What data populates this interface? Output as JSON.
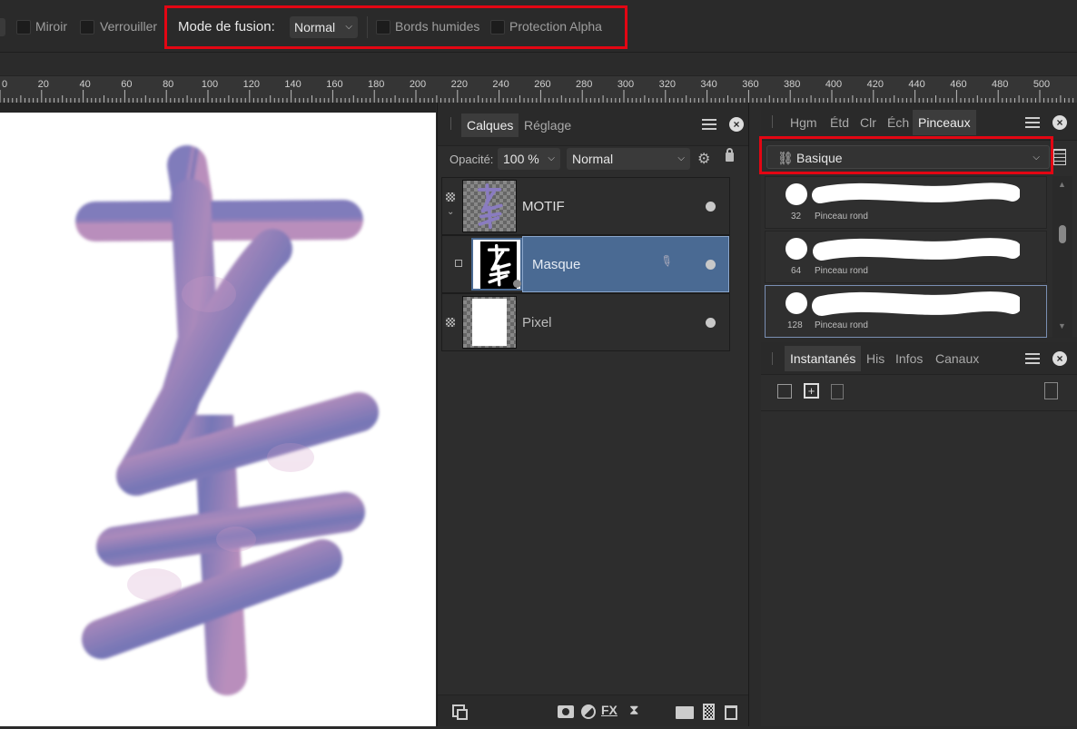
{
  "toolbar": {
    "mirror_label": "Miroir",
    "lock_label": "Verrouiller",
    "blend_mode_label": "Mode de fusion:",
    "blend_mode_value": "Normal",
    "wet_edges_label": "Bords humides",
    "protect_alpha_label": "Protection Alpha"
  },
  "ruler": {
    "ticks": [
      "0",
      "20",
      "40",
      "60",
      "80",
      "100",
      "120",
      "140",
      "160",
      "180",
      "200",
      "220",
      "240",
      "260",
      "280",
      "300",
      "320",
      "340",
      "360",
      "380",
      "400",
      "420",
      "440",
      "460",
      "480",
      "500"
    ]
  },
  "layers_panel": {
    "tabs": [
      "Calques",
      "Réglage"
    ],
    "opacity_label": "Opacité:",
    "opacity_value": "100 %",
    "blend_value": "Normal",
    "layers": [
      {
        "name": "MOTIF"
      },
      {
        "name": "Masque"
      },
      {
        "name": "Pixel"
      }
    ],
    "bottom_icons": [
      "layers-stack-icon",
      "mask-icon",
      "adjustment-icon",
      "fx-icon",
      "hourglass-icon",
      "folder-icon",
      "group-icon",
      "trash-icon"
    ]
  },
  "brushes_panel": {
    "tabs": [
      "Hgm",
      "Étd",
      "Clr",
      "Éch",
      "Pinceaux"
    ],
    "category_value": "Basique",
    "brushes": [
      {
        "size": "32",
        "name": "Pinceau rond"
      },
      {
        "size": "64",
        "name": "Pinceau rond"
      },
      {
        "size": "128",
        "name": "Pinceau rond"
      }
    ]
  },
  "snapshots_panel": {
    "tabs": [
      "Instantanés",
      "His",
      "Infos",
      "Canaux"
    ]
  },
  "colors": {
    "highlight_red": "#e30613",
    "selected_layer": "#4a6a93",
    "stroke_purple": "#7a74b8",
    "stroke_pink": "#b689b9"
  }
}
